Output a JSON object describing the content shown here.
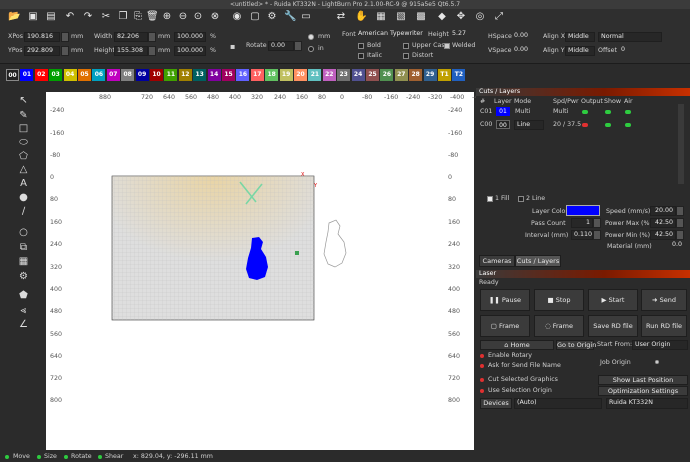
{
  "window": {
    "title": "<untitled> * - Ruida KT332N - LightBurn Pro 2.1.00-RC-9 @ 915a5e5 Qt6.5.7"
  },
  "toolbar": {
    "icons": [
      "folder-open-icon",
      "save-icon",
      "save-as-icon",
      "undo-icon",
      "redo-icon",
      "cut-icon",
      "copy-icon",
      "paste-icon",
      "delete-icon",
      "zoom-in-icon",
      "zoom-out-icon",
      "zoom-fit-icon",
      "zoom-page-icon",
      "camera-icon",
      "frame-icon",
      "settings-icon",
      "wrench-icon",
      "monitor-icon",
      "flip-icon",
      "hand-icon",
      "save-file-icon",
      "trace-icon",
      "fill-icon",
      "flip-h-icon",
      "pan-icon",
      "select-icon",
      "resize-icon"
    ]
  },
  "props": {
    "xpos_label": "XPos",
    "xpos": "190.816",
    "ypos_label": "YPos",
    "ypos": "292.809",
    "unit": "mm",
    "width_label": "Width",
    "width": "82.206",
    "height_label": "Height",
    "height": "155.308",
    "pct_w": "100.000",
    "pct_h": "100.000",
    "pct": "%",
    "rotate_label": "Rotate",
    "rotate": "0.00",
    "mm_opt": "mm",
    "in_opt": "in",
    "font_label": "Font",
    "font": "American Typewriter",
    "font_height_label": "Height",
    "font_height": "5.27",
    "bold": "Bold",
    "italic": "Italic",
    "upper": "Upper Case",
    "welded": "Welded",
    "distort": "Distort",
    "hspace_label": "HSpace",
    "hspace": "0.00",
    "vspace_label": "VSpace",
    "vspace": "0.00",
    "alignx_label": "Align X",
    "alignx": "Middle",
    "aligny_label": "Align Y",
    "aligny": "Middle",
    "normal": "Normal",
    "offset_label": "Offset",
    "offset": "0"
  },
  "palette": {
    "labels": [
      "00",
      "01",
      "02",
      "03",
      "04",
      "05",
      "06",
      "07",
      "08",
      "09",
      "10",
      "11",
      "12",
      "13",
      "14",
      "15",
      "16",
      "17",
      "18",
      "19",
      "20",
      "21",
      "22",
      "23",
      "24",
      "25",
      "26",
      "27",
      "28",
      "29",
      "T1",
      "T2"
    ],
    "colors": [
      "#222222",
      "#0000ff",
      "#ff0000",
      "#00a000",
      "#d0c000",
      "#e07000",
      "#00a0c0",
      "#c000c0",
      "#808080",
      "#0000a0",
      "#a00000",
      "#40a000",
      "#a08000",
      "#006060",
      "#8000a0",
      "#a00060",
      "#6060ff",
      "#ff6060",
      "#60c060",
      "#c0c060",
      "#ff9060",
      "#60c0c0",
      "#c060c0",
      "#707070",
      "#505090",
      "#905050",
      "#509050",
      "#909050",
      "#a06030",
      "#306090",
      "#c0a000",
      "#2060c0"
    ]
  },
  "lefttools": [
    "select-icon",
    "draw-line-icon",
    "rectangle-icon",
    "ellipse-icon",
    "polygon-icon",
    "text-icon",
    "position-icon",
    "measure-icon",
    "circle-icon",
    "array-icon",
    "grid-array-icon",
    "settings-gear-icon",
    "edit-nodes-icon",
    "tabs-icon"
  ],
  "ruler": {
    "top": [
      "880",
      "720",
      "640",
      "560",
      "480",
      "400",
      "320",
      "240",
      "160",
      "80",
      "0",
      "-80",
      "-160",
      "-240",
      "-320",
      "-400",
      "-480"
    ],
    "left": [
      "-240",
      "-160",
      "-80",
      "0",
      "80",
      "160",
      "240",
      "320",
      "400",
      "480",
      "560",
      "640",
      "720",
      "800"
    ]
  },
  "cuts": {
    "title": "Cuts / Layers",
    "headers": [
      "#",
      "Layer",
      "Mode",
      "Spd/Pwr",
      "Output",
      "Show",
      "Air"
    ],
    "rows": [
      {
        "num": "C01",
        "layer": "01",
        "mode": "Multi",
        "spdpwr": "Multi"
      },
      {
        "num": "C00",
        "layer": "00",
        "mode": "Line",
        "spdpwr": "20 / 37.5"
      }
    ]
  },
  "layer": {
    "fill": "1 Fill",
    "line": "2 Line",
    "color_label": "Layer Color",
    "pass_label": "Pass Count",
    "pass": "1",
    "interval_label": "Interval (mm)",
    "interval": "0.110",
    "speed_label": "Speed (mm/s)",
    "speed": "20.00",
    "pmax_label": "Power Max (%)",
    "pmax": "42.50",
    "pmin_label": "Power Min (%)",
    "pmin": "42.50",
    "material_label": "Material (mm)",
    "material": "0.0"
  },
  "tabs": {
    "cameras": "Cameras",
    "cutlayers": "Cuts / Layers"
  },
  "laser": {
    "title": "Laser",
    "status": "Ready",
    "pause": "Pause",
    "stop": "Stop",
    "start": "Start",
    "send": "Send",
    "frame1": "Frame",
    "frame2": "Frame",
    "save_rd": "Save RD file",
    "run_rd": "Run RD file",
    "home": "Home",
    "goto": "Go to Origin",
    "start_from_label": "Start From:",
    "start_from": "User Origin",
    "job_origin": "Job Origin",
    "rotary": "Enable Rotary",
    "ask_name": "Ask for Send File Name",
    "cut_selected": "Cut Selected Graphics",
    "use_selection": "Use Selection Origin",
    "show_last": "Show Last Position",
    "optim": "Optimization Settings",
    "devices": "Devices",
    "auto": "(Auto)",
    "device": "Ruida KT332N"
  },
  "status": {
    "move": "Move",
    "size": "Size",
    "rotate": "Rotate",
    "shear": "Shear",
    "coords": "x: 829.04, y: -296.11 mm"
  },
  "colors": {
    "accent": "#c83000",
    "layer_blue": "#0000ff"
  }
}
